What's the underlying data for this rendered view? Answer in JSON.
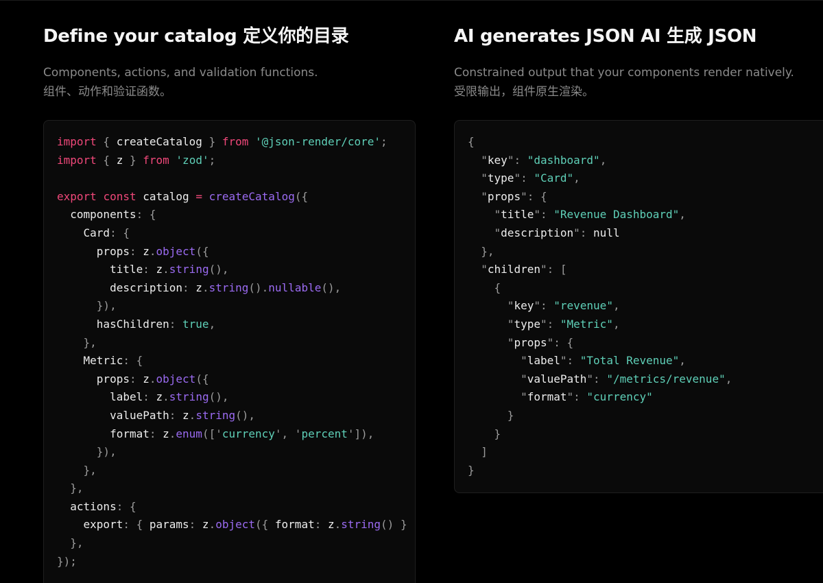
{
  "left": {
    "title": "Define your catalog  定义你的目录",
    "desc_en": "Components, actions, and validation functions.",
    "desc_zh": "组件、动作和验证函数。",
    "code": [
      [
        [
          "kw",
          "import"
        ],
        [
          "p",
          " { "
        ],
        [
          "id",
          "createCatalog"
        ],
        [
          "p",
          " } "
        ],
        [
          "kw",
          "from"
        ],
        [
          "p",
          " "
        ],
        [
          "str",
          "'@json-render/core'"
        ],
        [
          "p",
          ";"
        ]
      ],
      [
        [
          "kw",
          "import"
        ],
        [
          "p",
          " { "
        ],
        [
          "id",
          "z"
        ],
        [
          "p",
          " } "
        ],
        [
          "kw",
          "from"
        ],
        [
          "p",
          " "
        ],
        [
          "str",
          "'zod'"
        ],
        [
          "p",
          ";"
        ]
      ],
      [],
      [
        [
          "kw",
          "export"
        ],
        [
          "p",
          " "
        ],
        [
          "kw",
          "const"
        ],
        [
          "p",
          " "
        ],
        [
          "id",
          "catalog"
        ],
        [
          "p",
          " "
        ],
        [
          "kw",
          "="
        ],
        [
          "p",
          " "
        ],
        [
          "fn",
          "createCatalog"
        ],
        [
          "p",
          "({"
        ]
      ],
      [
        [
          "p",
          "  "
        ],
        [
          "id",
          "components"
        ],
        [
          "p",
          ": {"
        ]
      ],
      [
        [
          "p",
          "    "
        ],
        [
          "id",
          "Card"
        ],
        [
          "p",
          ": {"
        ]
      ],
      [
        [
          "p",
          "      "
        ],
        [
          "id",
          "props"
        ],
        [
          "p",
          ": "
        ],
        [
          "id",
          "z"
        ],
        [
          "p",
          "."
        ],
        [
          "fn",
          "object"
        ],
        [
          "p",
          "({"
        ]
      ],
      [
        [
          "p",
          "        "
        ],
        [
          "id",
          "title"
        ],
        [
          "p",
          ": "
        ],
        [
          "id",
          "z"
        ],
        [
          "p",
          "."
        ],
        [
          "fn",
          "string"
        ],
        [
          "p",
          "(),"
        ]
      ],
      [
        [
          "p",
          "        "
        ],
        [
          "id",
          "description"
        ],
        [
          "p",
          ": "
        ],
        [
          "id",
          "z"
        ],
        [
          "p",
          "."
        ],
        [
          "fn",
          "string"
        ],
        [
          "p",
          "()."
        ],
        [
          "fn",
          "nullable"
        ],
        [
          "p",
          "(),"
        ]
      ],
      [
        [
          "p",
          "      }),"
        ]
      ],
      [
        [
          "p",
          "      "
        ],
        [
          "id",
          "hasChildren"
        ],
        [
          "p",
          ": "
        ],
        [
          "str",
          "true"
        ],
        [
          "p",
          ","
        ]
      ],
      [
        [
          "p",
          "    },"
        ]
      ],
      [
        [
          "p",
          "    "
        ],
        [
          "id",
          "Metric"
        ],
        [
          "p",
          ": {"
        ]
      ],
      [
        [
          "p",
          "      "
        ],
        [
          "id",
          "props"
        ],
        [
          "p",
          ": "
        ],
        [
          "id",
          "z"
        ],
        [
          "p",
          "."
        ],
        [
          "fn",
          "object"
        ],
        [
          "p",
          "({"
        ]
      ],
      [
        [
          "p",
          "        "
        ],
        [
          "id",
          "label"
        ],
        [
          "p",
          ": "
        ],
        [
          "id",
          "z"
        ],
        [
          "p",
          "."
        ],
        [
          "fn",
          "string"
        ],
        [
          "p",
          "(),"
        ]
      ],
      [
        [
          "p",
          "        "
        ],
        [
          "id",
          "valuePath"
        ],
        [
          "p",
          ": "
        ],
        [
          "id",
          "z"
        ],
        [
          "p",
          "."
        ],
        [
          "fn",
          "string"
        ],
        [
          "p",
          "(),"
        ]
      ],
      [
        [
          "p",
          "        "
        ],
        [
          "id",
          "format"
        ],
        [
          "p",
          ": "
        ],
        [
          "id",
          "z"
        ],
        [
          "p",
          "."
        ],
        [
          "fn",
          "enum"
        ],
        [
          "p",
          "(['"
        ],
        [
          "str",
          "currency"
        ],
        [
          "p",
          "', '"
        ],
        [
          "str",
          "percent"
        ],
        [
          "p",
          "']),"
        ]
      ],
      [
        [
          "p",
          "      }),"
        ]
      ],
      [
        [
          "p",
          "    },"
        ]
      ],
      [
        [
          "p",
          "  },"
        ]
      ],
      [
        [
          "p",
          "  "
        ],
        [
          "id",
          "actions"
        ],
        [
          "p",
          ": {"
        ]
      ],
      [
        [
          "p",
          "    "
        ],
        [
          "id",
          "export"
        ],
        [
          "p",
          ": { "
        ],
        [
          "id",
          "params"
        ],
        [
          "p",
          ": "
        ],
        [
          "id",
          "z"
        ],
        [
          "p",
          "."
        ],
        [
          "fn",
          "object"
        ],
        [
          "p",
          "({ "
        ],
        [
          "id",
          "format"
        ],
        [
          "p",
          ": "
        ],
        [
          "id",
          "z"
        ],
        [
          "p",
          "."
        ],
        [
          "fn",
          "string"
        ],
        [
          "p",
          "() }"
        ]
      ],
      [
        [
          "p",
          "  },"
        ]
      ],
      [
        [
          "p",
          "});"
        ]
      ]
    ]
  },
  "right": {
    "title": "AI generates JSON  AI 生成 JSON",
    "desc_en": "Constrained output that your components render natively.",
    "desc_zh": "受限输出，组件原生渲染。",
    "code": [
      [
        [
          "p",
          "{"
        ]
      ],
      [
        [
          "p",
          "  \""
        ],
        [
          "id",
          "key"
        ],
        [
          "p",
          "\": "
        ],
        [
          "str",
          "\"dashboard\""
        ],
        [
          "p",
          ","
        ]
      ],
      [
        [
          "p",
          "  \""
        ],
        [
          "id",
          "type"
        ],
        [
          "p",
          "\": "
        ],
        [
          "str",
          "\"Card\""
        ],
        [
          "p",
          ","
        ]
      ],
      [
        [
          "p",
          "  \""
        ],
        [
          "id",
          "props"
        ],
        [
          "p",
          "\": {"
        ]
      ],
      [
        [
          "p",
          "    \""
        ],
        [
          "id",
          "title"
        ],
        [
          "p",
          "\": "
        ],
        [
          "str",
          "\"Revenue Dashboard\""
        ],
        [
          "p",
          ","
        ]
      ],
      [
        [
          "p",
          "    \""
        ],
        [
          "id",
          "description"
        ],
        [
          "p",
          "\": "
        ],
        [
          "id",
          "null"
        ]
      ],
      [
        [
          "p",
          "  },"
        ]
      ],
      [
        [
          "p",
          "  \""
        ],
        [
          "id",
          "children"
        ],
        [
          "p",
          "\": ["
        ]
      ],
      [
        [
          "p",
          "    {"
        ]
      ],
      [
        [
          "p",
          "      \""
        ],
        [
          "id",
          "key"
        ],
        [
          "p",
          "\": "
        ],
        [
          "str",
          "\"revenue\""
        ],
        [
          "p",
          ","
        ]
      ],
      [
        [
          "p",
          "      \""
        ],
        [
          "id",
          "type"
        ],
        [
          "p",
          "\": "
        ],
        [
          "str",
          "\"Metric\""
        ],
        [
          "p",
          ","
        ]
      ],
      [
        [
          "p",
          "      \""
        ],
        [
          "id",
          "props"
        ],
        [
          "p",
          "\": {"
        ]
      ],
      [
        [
          "p",
          "        \""
        ],
        [
          "id",
          "label"
        ],
        [
          "p",
          "\": "
        ],
        [
          "str",
          "\"Total Revenue\""
        ],
        [
          "p",
          ","
        ]
      ],
      [
        [
          "p",
          "        \""
        ],
        [
          "id",
          "valuePath"
        ],
        [
          "p",
          "\": "
        ],
        [
          "str",
          "\"/metrics/revenue\""
        ],
        [
          "p",
          ","
        ]
      ],
      [
        [
          "p",
          "        \""
        ],
        [
          "id",
          "format"
        ],
        [
          "p",
          "\": "
        ],
        [
          "str",
          "\"currency\""
        ]
      ],
      [
        [
          "p",
          "      }"
        ]
      ],
      [
        [
          "p",
          "    }"
        ]
      ],
      [
        [
          "p",
          "  ]"
        ]
      ],
      [
        [
          "p",
          "}"
        ]
      ]
    ]
  }
}
